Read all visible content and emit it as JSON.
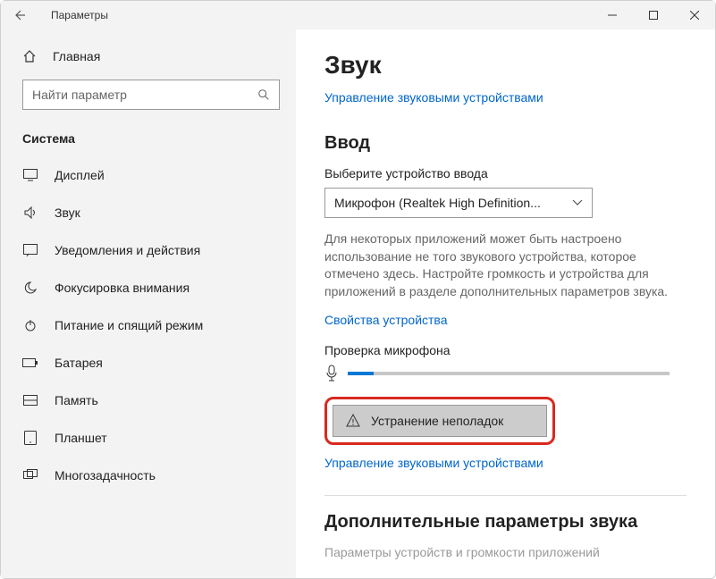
{
  "window": {
    "title": "Параметры"
  },
  "sidebar": {
    "home": "Главная",
    "search_placeholder": "Найти параметр",
    "section": "Система",
    "items": [
      {
        "label": "Дисплей",
        "icon": "display-icon"
      },
      {
        "label": "Звук",
        "icon": "sound-icon"
      },
      {
        "label": "Уведомления и действия",
        "icon": "notifications-icon"
      },
      {
        "label": "Фокусировка внимания",
        "icon": "focus-icon"
      },
      {
        "label": "Питание и спящий режим",
        "icon": "power-icon"
      },
      {
        "label": "Батарея",
        "icon": "battery-icon"
      },
      {
        "label": "Память",
        "icon": "storage-icon"
      },
      {
        "label": "Планшет",
        "icon": "tablet-icon"
      },
      {
        "label": "Многозадачность",
        "icon": "multitasking-icon"
      }
    ]
  },
  "content": {
    "heading": "Звук",
    "manage_devices_link": "Управление звуковыми устройствами",
    "input_heading": "Ввод",
    "input_select_label": "Выберите устройство ввода",
    "input_selected": "Микрофон (Realtek High Definition...",
    "input_desc": "Для некоторых приложений может быть настроено использование не того звукового устройства, которое отмечено здесь. Настройте громкость и устройства для приложений в разделе дополнительных параметров звука.",
    "device_properties_link": "Свойства устройства",
    "mic_check_label": "Проверка микрофона",
    "troubleshoot_label": "Устранение неполадок",
    "manage_devices_link2": "Управление звуковыми устройствами",
    "advanced_heading": "Дополнительные параметры звука",
    "advanced_cut": "Параметры устройств и громкости приложений"
  }
}
